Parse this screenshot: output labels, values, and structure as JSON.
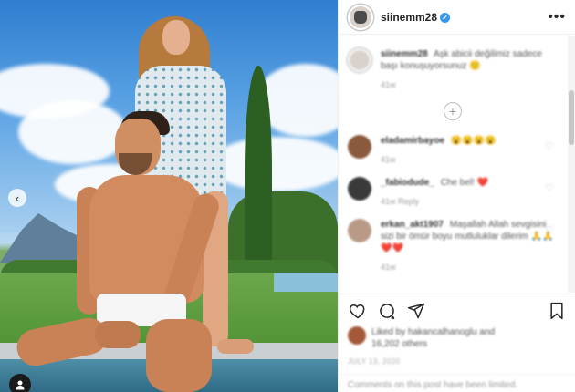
{
  "post": {
    "username": "siinemm28",
    "verified": true,
    "more_icon": "more-horizontal-icon"
  },
  "caption": {
    "username": "siinemm28",
    "text": "Aşk abicii değilimiz sadece başı konuşuyorsunuz",
    "emoji": "🙂",
    "time": "41w"
  },
  "load_more_icon": "plus-circle-icon",
  "comments": [
    {
      "username": "eladamirbayoe",
      "text": "",
      "emojis": "😮😮😮😮",
      "meta": "41w",
      "avatar_color": "#8a5a3e"
    },
    {
      "username": "_fabiodude_",
      "text": "Che bel!",
      "emojis": "❤️",
      "meta": "41w   Reply",
      "avatar_color": "#3a3a3a"
    },
    {
      "username": "erkan_akt1907",
      "text": "Maşallah Allah sevgisini sizi bir ömür boyu mutluluklar dilerim",
      "emojis": "🙏🙏❤️❤️",
      "meta": "41w",
      "avatar_color": "#b99a86"
    }
  ],
  "actions": {
    "like_icon": "heart-icon",
    "comment_icon": "comment-icon",
    "share_icon": "send-icon",
    "save_icon": "bookmark-icon"
  },
  "likes": {
    "text_line1": "Liked by hakancalhanoglu and",
    "text_line2": "16,202 others"
  },
  "date": "JULY 13, 2020",
  "comments_disabled": "Comments on this post have been limited."
}
